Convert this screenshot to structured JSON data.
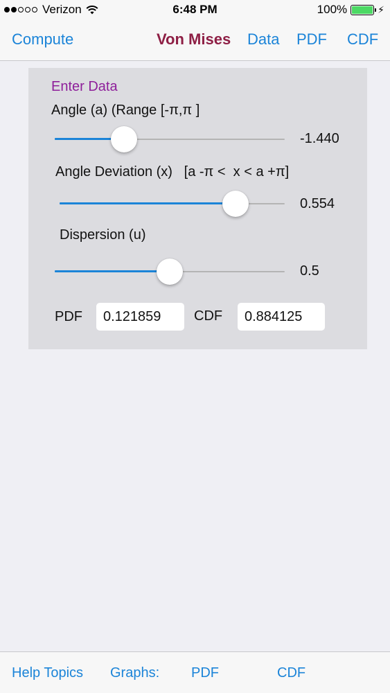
{
  "status_bar": {
    "carrier": "Verizon",
    "signal_bars_filled": 2,
    "signal_bars_total": 5,
    "time": "6:48 PM",
    "battery_percent": "100%",
    "icons": [
      "wifi-icon",
      "battery-icon",
      "charging-icon"
    ],
    "battery_color": "#4cd964"
  },
  "nav": {
    "left_button": "Compute",
    "title": "Von Mises",
    "items": [
      "Data",
      "PDF",
      "CDF"
    ],
    "accent_color": "#1b84d8",
    "title_color": "#8e1f45"
  },
  "panel": {
    "section_title": "Enter Data",
    "angle": {
      "label": "Angle (a) (Range [-π,π ]",
      "value_text": "-1.440",
      "position_fraction": 0.3
    },
    "deviation": {
      "label": "Angle Deviation (x)   [a -π <  x < a +π]",
      "value_text": "0.554",
      "position_fraction": 0.78
    },
    "dispersion": {
      "label": "Dispersion (u)",
      "value_text": "0.5",
      "position_fraction": 0.5
    },
    "results": {
      "pdf_label": "PDF",
      "pdf_value": "0.121859",
      "cdf_label": "CDF",
      "cdf_value": "0.884125"
    }
  },
  "toolbar": {
    "help_topics": "Help Topics",
    "graphs_label": "Graphs:",
    "pdf": "PDF",
    "cdf": "CDF"
  }
}
